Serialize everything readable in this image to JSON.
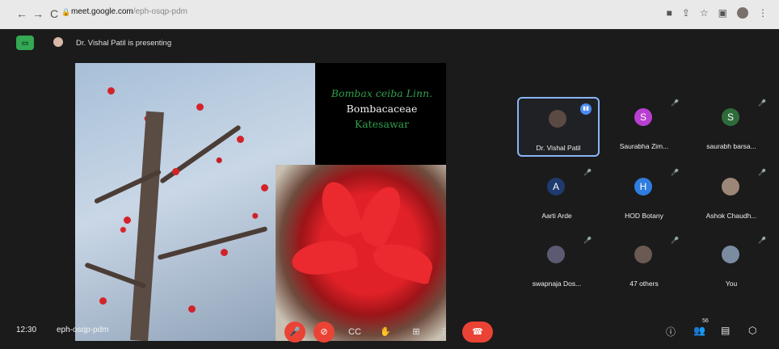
{
  "browser": {
    "nav_back": "←",
    "nav_forward": "→",
    "reload": "C",
    "url_host": "meet.google.com",
    "url_path": "/eph-osqp-pdm"
  },
  "meet": {
    "presenting_text": "Dr. Vishal Patil is presenting",
    "slide": {
      "latin_name": "Bombax ceiba",
      "author": "Linn.",
      "family": "Bombacaceae",
      "local_name": "Katesawar"
    },
    "participants": [
      {
        "name": "Dr. Vishal Patil",
        "initial": "",
        "avatar_color": "#5b4a44",
        "active": true
      },
      {
        "name": "Saurabha Zim...",
        "initial": "S",
        "avatar_color": "#b93fd1"
      },
      {
        "name": "saurabh barsa...",
        "initial": "S",
        "avatar_color": "#2e6b3a"
      },
      {
        "name": "Aarti Arde",
        "initial": "A",
        "avatar_color": "#1f3a6e"
      },
      {
        "name": "HOD Botany",
        "initial": "H",
        "avatar_color": "#2f7de0"
      },
      {
        "name": "Ashok Chaudh...",
        "initial": "",
        "avatar_color": "#9b8677"
      },
      {
        "name": "swapnaja Dos...",
        "initial": "",
        "avatar_color": "#5c5a73"
      },
      {
        "name": "47 others",
        "initial": "",
        "avatar_color": "#6a5a52"
      },
      {
        "name": "You",
        "initial": "",
        "avatar_color": "#7b8ba0"
      }
    ],
    "bottom": {
      "time": "12:30",
      "meeting_code": "eph-osqp-pdm",
      "people_count": "56"
    }
  }
}
